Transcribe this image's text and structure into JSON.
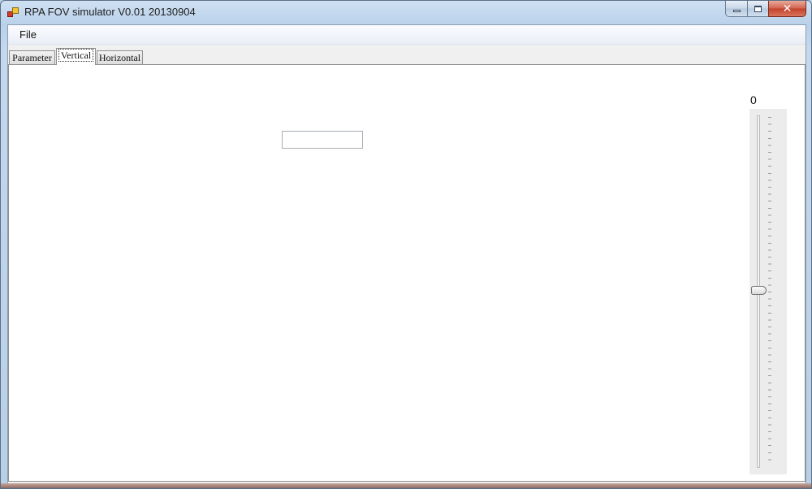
{
  "window": {
    "title": "RPA FOV simulator V0.01 20130904",
    "icon": "app-icon"
  },
  "caption_buttons": {
    "minimize_icon": "minimize-icon",
    "maximize_icon": "maximize-icon",
    "close_icon": "close-icon",
    "close_glyph": "✕"
  },
  "menu": {
    "items": [
      {
        "label": "File"
      }
    ]
  },
  "tabs": [
    {
      "label": "Parameter",
      "selected": false
    },
    {
      "label": "Vertical",
      "selected": true
    },
    {
      "label": "Horizontal",
      "selected": false
    }
  ],
  "vertical_page": {
    "textbox_value": "",
    "trackbar_value_label": "0",
    "trackbar": {
      "value": 0,
      "position_fraction": 0.5
    }
  }
}
